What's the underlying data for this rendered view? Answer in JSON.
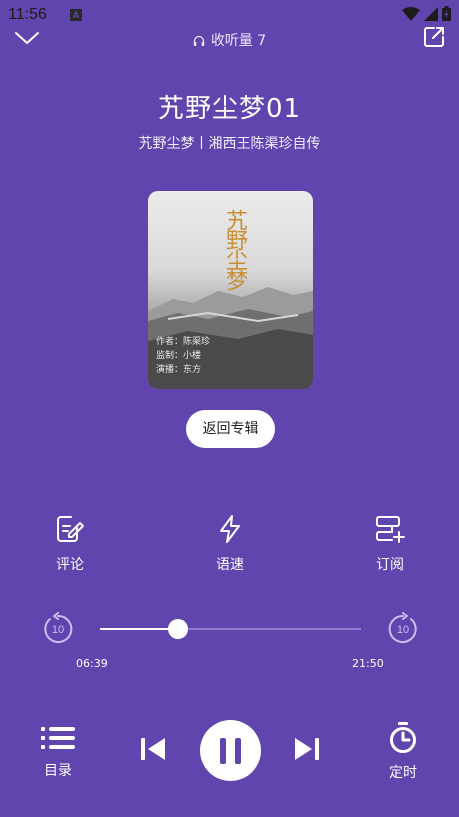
{
  "status": {
    "time": "11:56",
    "notif_icon": "A"
  },
  "header": {
    "listen_label": "收听量 7"
  },
  "track": {
    "title": "艽野尘梦01",
    "subtitle": "艽野尘梦丨湘西王陈渠珍自传"
  },
  "cover": {
    "title": "艽野尘梦",
    "credits": [
      "作者：陈渠珍",
      "监制：小楼",
      "演播：东方"
    ]
  },
  "back_button": "返回专辑",
  "actions": {
    "comment": "评论",
    "speed": "语速",
    "subscribe": "订阅"
  },
  "progress": {
    "current": "06:39",
    "total": "21:50",
    "fraction": 0.3,
    "skip_back": "10",
    "skip_forward": "10"
  },
  "bottom": {
    "playlist": "目录",
    "timer": "定时"
  },
  "colors": {
    "background": "#5f45ad",
    "accent": "#ffffff"
  }
}
